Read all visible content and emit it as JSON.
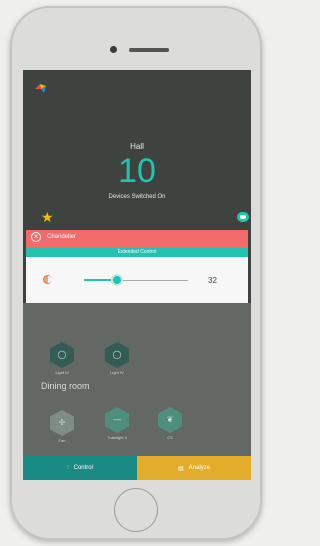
{
  "hall": {
    "room_name": "Hall",
    "devices_on_count": "10",
    "devices_on_label": "Devices Switched On"
  },
  "card": {
    "title": "Chandelier",
    "subtitle": "Extended Control",
    "slider_value": "32",
    "slider_level_percent": 32
  },
  "hall_devices": [
    {
      "label": "Light III",
      "icon": "light-bulb-icon"
    },
    {
      "label": "Light IV",
      "icon": "light-bulb-icon"
    }
  ],
  "dining": {
    "title": "Dining room",
    "devices": [
      {
        "label": "Fan",
        "icon": "fan-icon"
      },
      {
        "label": "Tubelight II",
        "icon": "tubelight-icon"
      },
      {
        "label": "CS",
        "icon": "leaf-icon"
      }
    ]
  },
  "tabs": {
    "control_label": "Control",
    "analyze_label": "Analyze"
  },
  "colors": {
    "accent": "#22c3b1",
    "header_red": "#f36a6a",
    "analyze_yellow": "#e1ad2a",
    "screen_bg": "#3e4340"
  }
}
